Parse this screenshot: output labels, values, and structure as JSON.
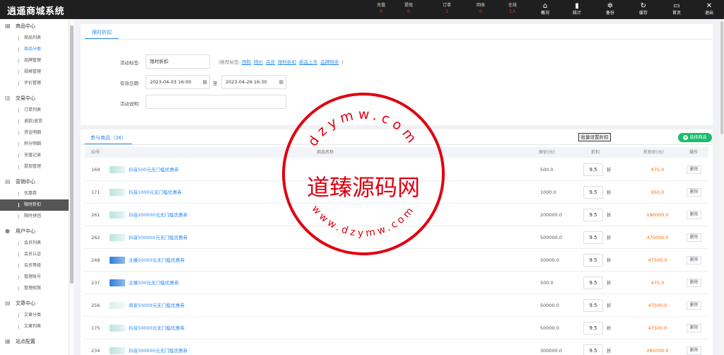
{
  "app_title": "逍遥商城系统",
  "header_stats": [
    {
      "label": "充值",
      "value": "0"
    },
    {
      "label": "提现",
      "value": "0"
    },
    {
      "label": "订单",
      "value": "1"
    },
    {
      "label": "回收",
      "value": "0"
    },
    {
      "label": "在线",
      "value": "1人"
    }
  ],
  "header_nav": [
    {
      "label": "概况",
      "icon": "home-icon",
      "glyph": "⌂"
    },
    {
      "label": "统计",
      "icon": "bar-chart-icon",
      "glyph": "▮"
    },
    {
      "label": "备份",
      "icon": "backup-icon",
      "glyph": "✲"
    },
    {
      "label": "缓存",
      "icon": "refresh-icon",
      "glyph": "↻"
    },
    {
      "label": "首页",
      "icon": "monitor-icon",
      "glyph": "▭"
    },
    {
      "label": "退出",
      "icon": "close-icon",
      "glyph": "✕"
    }
  ],
  "sidebar": {
    "groups": [
      {
        "title": "商品中心",
        "icon": "goods-icon",
        "glyph": "▦",
        "items": [
          "商品列表",
          "商品分类",
          "品牌管理",
          "规格管理",
          "评价管理"
        ]
      },
      {
        "title": "交易中心",
        "icon": "trade-icon",
        "glyph": "▥",
        "items": [
          "订单列表",
          "退款/退货",
          "资金明细",
          "积分明细",
          "充值记录",
          "提现管理"
        ]
      },
      {
        "title": "营销中心",
        "icon": "marketing-icon",
        "glyph": "▤",
        "items": [
          "优惠券",
          "限时折扣",
          "限时拼团"
        ]
      },
      {
        "title": "用户中心",
        "icon": "user-icon",
        "glyph": "●",
        "items": [
          "会员列表",
          "会员认证",
          "会员等级",
          "管理账号",
          "管理权限"
        ]
      },
      {
        "title": "文章中心",
        "icon": "article-icon",
        "glyph": "▤",
        "items": [
          "文章分类",
          "文章列表"
        ]
      },
      {
        "title": "站点配置",
        "icon": "settings-icon",
        "glyph": "▦",
        "items": []
      }
    ],
    "active_item": "限时折扣",
    "highlight_item": "商品分类"
  },
  "form": {
    "tab": "限时折扣",
    "title_label": "活动标签:",
    "title_value": "限时折扣",
    "tips_prefix": "(推荐标签:",
    "tips": [
      "团购",
      "特价",
      "店庆",
      "限时折扣",
      "新品上市",
      "品牌特卖"
    ],
    "tips_suffix": ")",
    "date_label": "有效日期:",
    "start_date": "2023-04-03 16:00",
    "to_label": "至",
    "end_date": "2023-04-29 16:30",
    "desc_label": "活动说明:",
    "desc_value": ""
  },
  "products": {
    "tab": "参与商品（36）",
    "batch_button": "批量设置折扣",
    "add_button": "选择商品",
    "columns": [
      "ID号",
      "商品名称",
      "原价(元)",
      "折扣",
      "折后价(元)",
      "操作"
    ],
    "discount_unit": "折",
    "delete_label": "删除",
    "rows": [
      {
        "id": "169",
        "name": "抖音500元无门槛优惠券",
        "price": "500.0",
        "discount": "9.5",
        "final": "475.0",
        "thumb": "t1"
      },
      {
        "id": "171",
        "name": "抖音1000元无门槛优惠券",
        "price": "1000.0",
        "discount": "9.5",
        "final": "950.0",
        "thumb": "t1"
      },
      {
        "id": "261",
        "name": "抖音200000元无门槛优惠券",
        "price": "200000.0",
        "discount": "9.5",
        "final": "190000.0",
        "thumb": "t1"
      },
      {
        "id": "262",
        "name": "抖音500000元无门槛优惠券",
        "price": "500000.0",
        "discount": "9.5",
        "final": "475000.0",
        "thumb": "t1"
      },
      {
        "id": "248",
        "name": "主播50000元无门槛优惠券",
        "price": "50000.0",
        "discount": "9.5",
        "final": "47500.0",
        "thumb": "t2"
      },
      {
        "id": "237",
        "name": "主播500元无门槛优惠券",
        "price": "500.0",
        "discount": "9.5",
        "final": "475.0",
        "thumb": "t2"
      },
      {
        "id": "256",
        "name": "商家50000元无门槛优惠券",
        "price": "50000.0",
        "discount": "9.5",
        "final": "47500.0",
        "thumb": "t3"
      },
      {
        "id": "175",
        "name": "抖音50000元无门槛优惠券",
        "price": "50000.0",
        "discount": "9.5",
        "final": "47500.0",
        "thumb": "t1"
      },
      {
        "id": "234",
        "name": "抖音300000元无门槛优惠券",
        "price": "300000.0",
        "discount": "9.5",
        "final": "285000.0",
        "thumb": "t1"
      }
    ]
  },
  "watermark": {
    "main": "道臻源码网",
    "top_arc": "dzymw.com",
    "bottom_arc": "www.dzymw.com",
    "color": "#e0000f"
  }
}
